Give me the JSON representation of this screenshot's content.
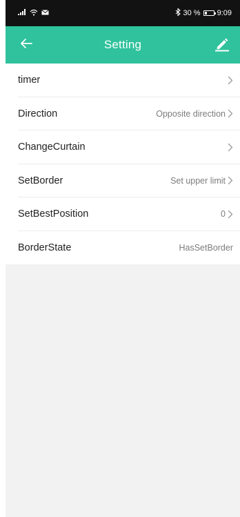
{
  "status_bar": {
    "signal_icon": "signal-icon",
    "wifi_icon": "wifi-icon",
    "mail_icon": "mail-icon",
    "bluetooth_icon": "bluetooth-icon",
    "battery_text": "30 %",
    "battery_level_pct": 30,
    "time": "9:09"
  },
  "app_bar": {
    "title": "Setting",
    "background_color": "#2fc29c",
    "back_icon": "arrow-left-icon",
    "edit_icon": "pencil-icon"
  },
  "settings": [
    {
      "label": "timer",
      "value": "",
      "chevron": true
    },
    {
      "label": "Direction",
      "value": "Opposite direction",
      "chevron": true
    },
    {
      "label": "ChangeCurtain",
      "value": "",
      "chevron": true
    },
    {
      "label": "SetBorder",
      "value": "Set upper limit",
      "chevron": true
    },
    {
      "label": "SetBestPosition",
      "value": "0",
      "chevron": true
    },
    {
      "label": "BorderState",
      "value": "HasSetBorder",
      "chevron": false
    }
  ]
}
